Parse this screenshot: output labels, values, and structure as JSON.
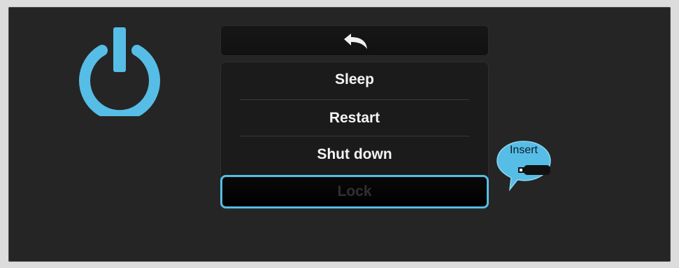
{
  "menu": {
    "back_icon": "back-arrow-icon",
    "items": [
      {
        "label": "Sleep"
      },
      {
        "label": "Restart"
      },
      {
        "label": "Shut down"
      },
      {
        "label": "Lock"
      }
    ]
  },
  "power": {
    "icon": "power-icon",
    "color": "#56bde6"
  },
  "insert_bubble": {
    "label": "Insert",
    "icon": "usb-drive-icon",
    "color": "#56bde6"
  }
}
